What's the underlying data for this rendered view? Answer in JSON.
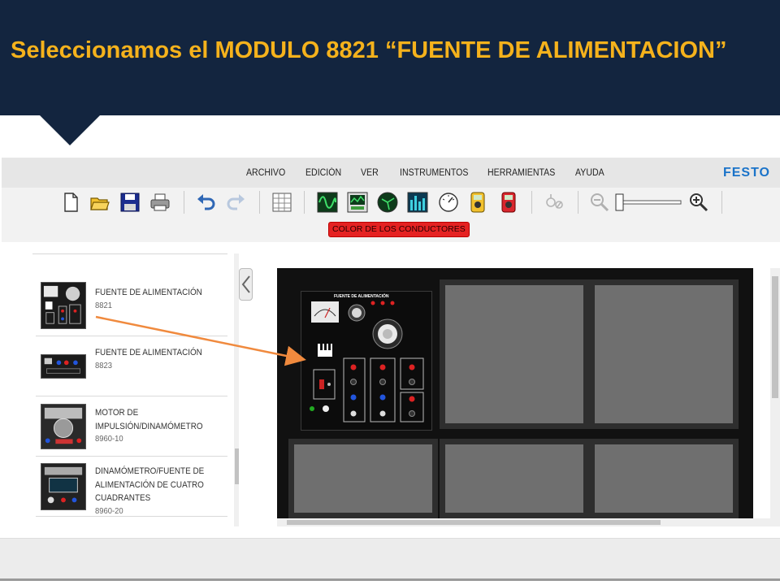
{
  "slide": {
    "title": "Seleccionamos el MODULO 8821 “FUENTE DE ALIMENTACION”"
  },
  "menu": {
    "items": [
      "ARCHIVO",
      "EDICIÓN",
      "VER",
      "INSTRUMENTOS",
      "HERRAMIENTAS",
      "AYUDA"
    ],
    "brand": "FESTO"
  },
  "toolbar": {
    "icons": [
      "new-file-icon",
      "open-folder-icon",
      "save-icon",
      "print-icon",
      "undo-icon",
      "redo-icon",
      "table-icon",
      "oscilloscope-icon",
      "recorder-icon",
      "phasor-analyzer-icon",
      "spectrum-analyzer-icon",
      "meter-icon",
      "yellow-multimeter-icon",
      "red-multimeter-icon",
      "disconnect-icon",
      "zoom-out-icon",
      "zoom-slider",
      "zoom-in-icon"
    ],
    "conductors_button": "COLOR DE LOS CONDUCTORES"
  },
  "modules": [
    {
      "name": "FUENTE DE ALIMENTACIÓN",
      "code": "8821"
    },
    {
      "name": "FUENTE DE ALIMENTACIÓN",
      "code": "8823"
    },
    {
      "name": "MOTOR DE IMPULSIÓN/DINAMÓMETRO",
      "code": "8960-10"
    },
    {
      "name": "DINAMÓMETRO/FUENTE DE ALIMENTACIÓN DE CUATRO CUADRANTES",
      "code": "8960-20"
    }
  ],
  "workspace": {
    "module_label": "FUENTE DE ALIMENTACIÓN"
  },
  "colors": {
    "header_bg": "#13253f",
    "title": "#f5b21c",
    "brand": "#1a73c9",
    "arrow": "#f08a3e",
    "conductors_button": "#e52222"
  }
}
